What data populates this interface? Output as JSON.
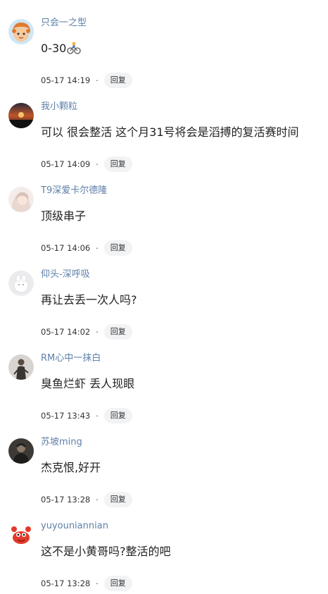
{
  "comments": [
    {
      "username": "只会一之型",
      "content": "0-30",
      "emoji": "bicycle-emoji",
      "time": "05-17 14:19",
      "reply_label": "回复"
    },
    {
      "username": "我小颗粒",
      "content": "可以 很会整活 这个月31号将会是滔搏的复活赛时间",
      "time": "05-17 14:09",
      "reply_label": "回复"
    },
    {
      "username": "T9深爱卡尔德隆",
      "content": "顶级串子",
      "time": "05-17 14:06",
      "reply_label": "回复"
    },
    {
      "username": "仰头-深呼吸",
      "content": "再让去丢一次人吗?",
      "time": "05-17 14:02",
      "reply_label": "回复"
    },
    {
      "username": "RM心中一抹白",
      "content": "臭鱼烂虾 丢人现眼",
      "time": "05-17 13:43",
      "reply_label": "回复"
    },
    {
      "username": "苏坡ming",
      "content": "杰克恨,好开",
      "time": "05-17 13:28",
      "reply_label": "回复"
    },
    {
      "username": "yuyouniannian",
      "content": "这不是小黄哥吗?整活的吧",
      "time": "05-17 13:28",
      "reply_label": "回复"
    }
  ],
  "colors": {
    "username": "#5e7fa8",
    "text": "#222222",
    "reply_bg": "#f2f3f5"
  }
}
